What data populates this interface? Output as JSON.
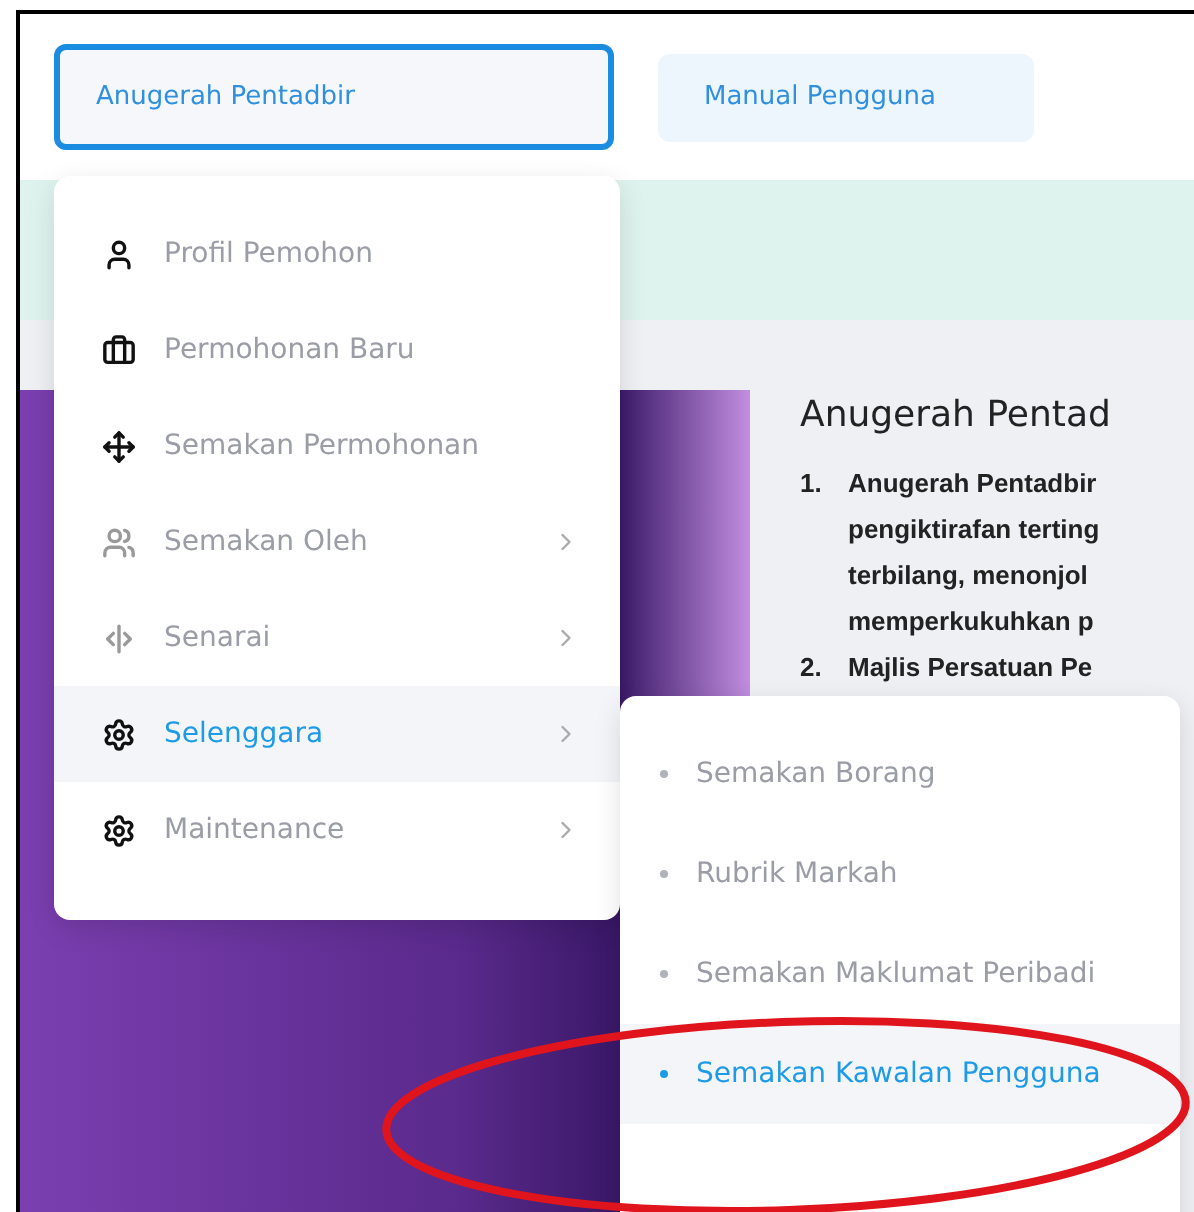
{
  "header": {
    "buttons": [
      {
        "label": "Anugerah Pentadbir",
        "selected": true
      },
      {
        "label": "Manual Pengguna",
        "selected": false
      }
    ]
  },
  "article": {
    "title": "Anugerah Pentad",
    "items": [
      {
        "number": "1.",
        "lines": [
          "Anugerah Pentadbir",
          "pengiktirafan terting",
          "terbilang, menonjol",
          "memperkukuhkan p"
        ]
      },
      {
        "number": "2.",
        "lines": [
          "Majlis Persatuan Pe"
        ]
      }
    ]
  },
  "menu": {
    "items": [
      {
        "label": "Profil Pemohon",
        "has_submenu": false,
        "selected": false
      },
      {
        "label": "Permohonan Baru",
        "has_submenu": false,
        "selected": false
      },
      {
        "label": "Semakan Permohonan",
        "has_submenu": false,
        "selected": false
      },
      {
        "label": "Semakan Oleh",
        "has_submenu": true,
        "selected": false
      },
      {
        "label": "Senarai",
        "has_submenu": true,
        "selected": false
      },
      {
        "label": "Selenggara",
        "has_submenu": true,
        "selected": true
      },
      {
        "label": "Maintenance",
        "has_submenu": true,
        "selected": false
      }
    ]
  },
  "submenu": {
    "items": [
      {
        "label": "Semakan Borang",
        "selected": false
      },
      {
        "label": "Rubrik Markah",
        "selected": false
      },
      {
        "label": "Semakan Maklumat Peribadi",
        "selected": false
      },
      {
        "label": "Semakan Kawalan Pengguna",
        "selected": true
      }
    ]
  }
}
